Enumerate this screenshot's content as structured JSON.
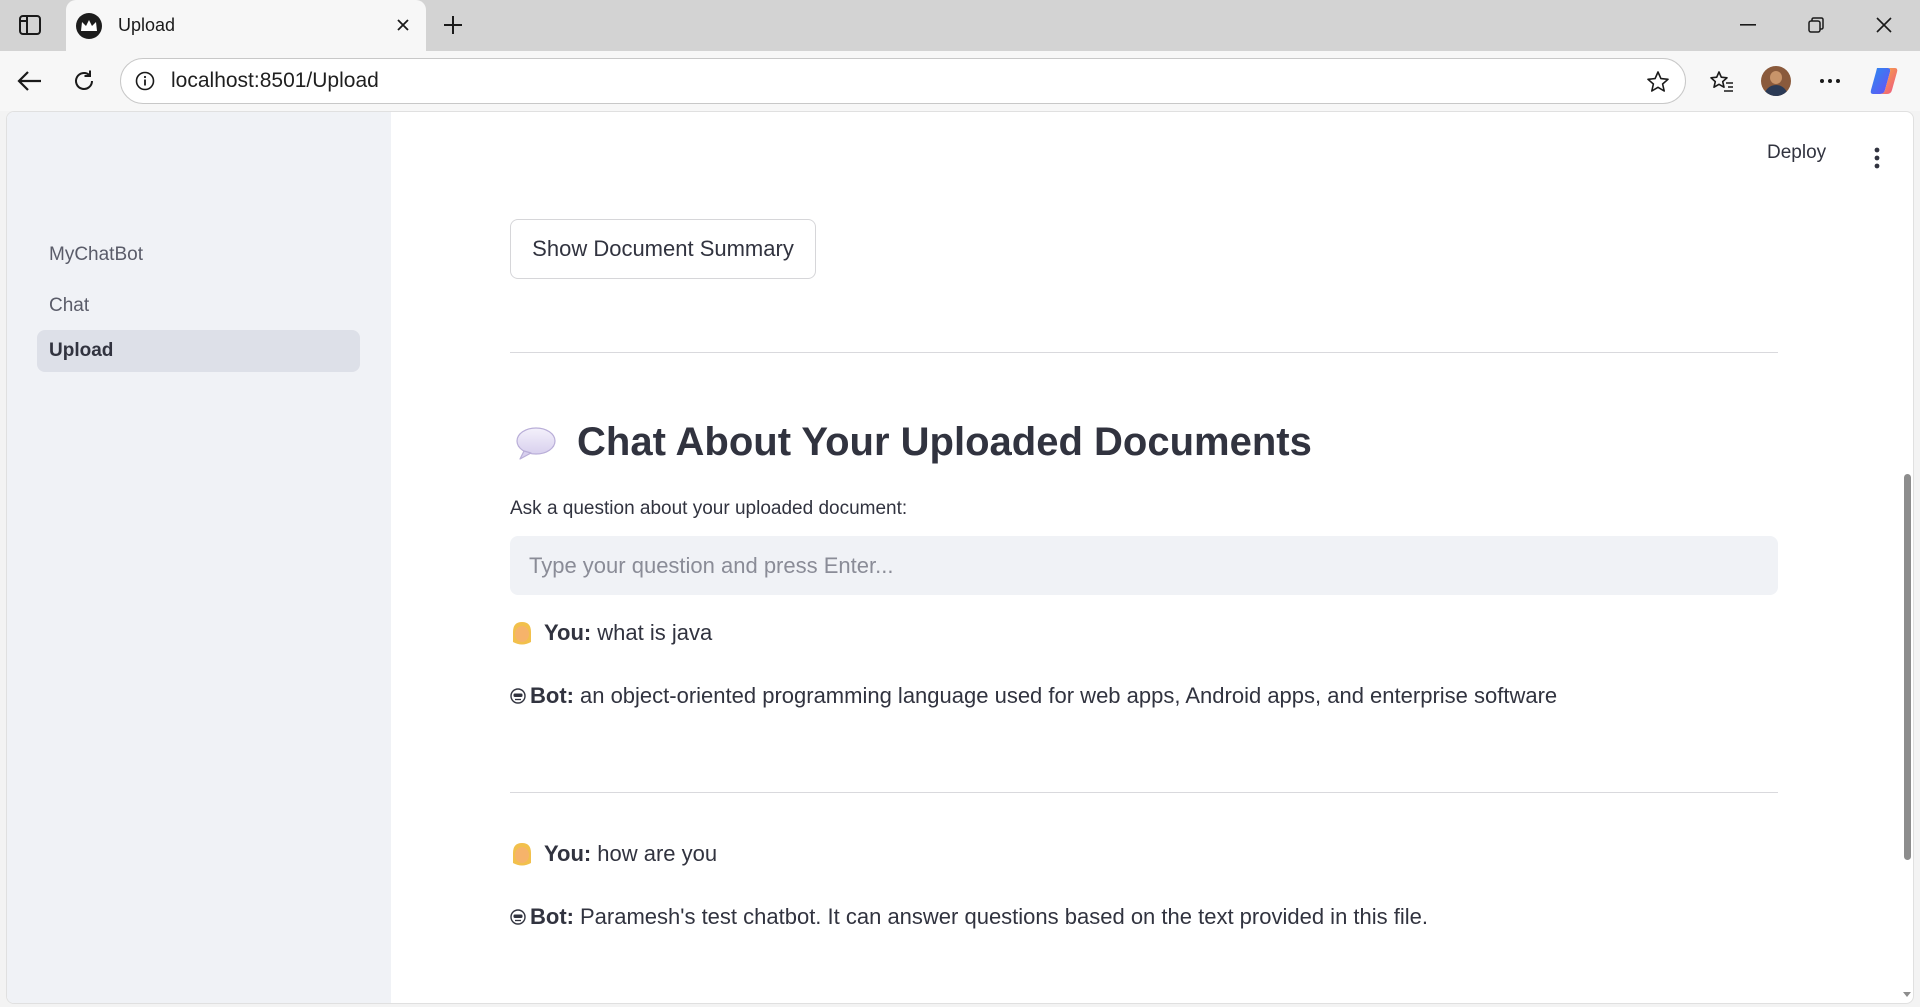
{
  "browser": {
    "tab_title": "Upload",
    "url": "localhost:8501/Upload"
  },
  "sidebar": {
    "items": [
      {
        "label": "MyChatBot",
        "active": false
      },
      {
        "label": "Chat",
        "active": false
      },
      {
        "label": "Upload",
        "active": true
      }
    ]
  },
  "header": {
    "deploy_label": "Deploy"
  },
  "main": {
    "summary_button": "Show Document Summary",
    "section_title": "Chat About Your Uploaded Documents",
    "input_label": "Ask a question about your uploaded document:",
    "input_placeholder": "Type your question and press Enter...",
    "input_value": "",
    "messages": [
      {
        "role": "user",
        "speaker": "You:",
        "text": "what is java"
      },
      {
        "role": "bot",
        "speaker": "Bot:",
        "text": "an object-oriented programming language used for web apps, Android apps, and enterprise software"
      },
      {
        "role": "user",
        "speaker": "You:",
        "text": "how are you"
      },
      {
        "role": "bot",
        "speaker": "Bot:",
        "text": "Paramesh's test chatbot. It can answer questions based on the text provided in this file."
      }
    ]
  },
  "icons": {
    "tab_actions": "tab-actions-icon",
    "favicon": "streamlit-crown-icon",
    "close": "close-icon",
    "new_tab": "plus-icon",
    "back": "back-arrow-icon",
    "refresh": "refresh-icon",
    "info": "info-icon",
    "favorite": "star-icon",
    "favorites": "favorites-icon",
    "profile": "avatar",
    "more": "more-icon",
    "copilot": "copilot-icon",
    "speech": "speech-balloon-icon",
    "user": "user-emoji-icon",
    "bot": "bot-emoji-icon"
  },
  "colors": {
    "sidebar_bg": "#f0f2f6",
    "active_nav_bg": "#dde0e8",
    "text": "#31333f",
    "input_bg": "#f0f2f6"
  }
}
